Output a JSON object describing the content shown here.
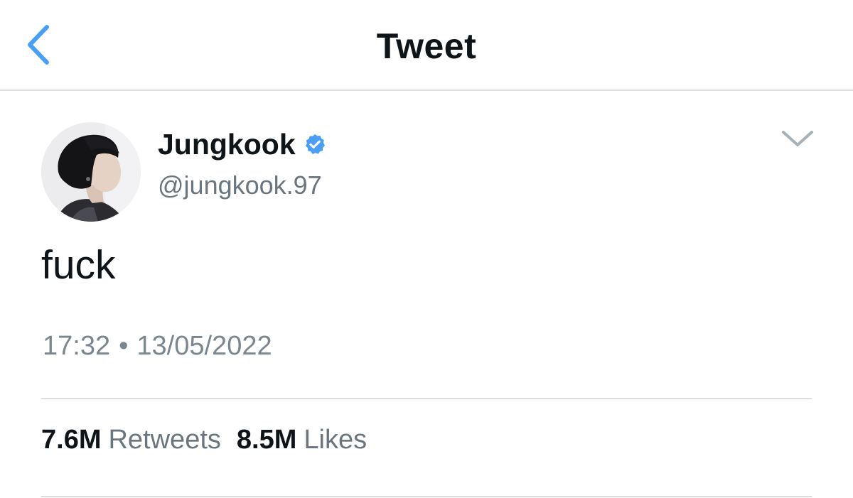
{
  "header": {
    "title": "Tweet",
    "back_icon": "chevron-left-icon"
  },
  "author": {
    "display_name": "Jungkook",
    "handle": "@jungkook.97",
    "verified": true,
    "verified_icon": "verified-badge-icon"
  },
  "tweet": {
    "text": "fuck",
    "time": "17:32",
    "separator": "•",
    "date": "13/05/2022"
  },
  "stats": {
    "retweets_count": "7.6M",
    "retweets_label": "Retweets",
    "likes_count": "8.5M",
    "likes_label": "Likes"
  },
  "colors": {
    "accent": "#4a9ff5",
    "text_primary": "#0f1419",
    "text_secondary": "#6a7580",
    "divider": "#d9dde0"
  }
}
